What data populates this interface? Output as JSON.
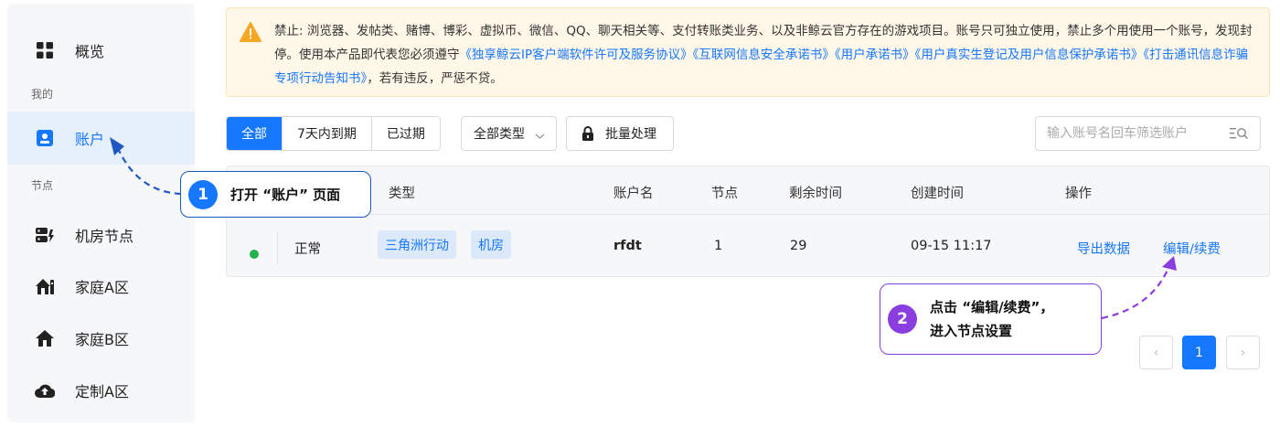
{
  "sidebar": {
    "overview_label": "概览",
    "group_mine": "我的",
    "account_label": "账户",
    "group_nodes": "节点",
    "items": [
      {
        "label": "机房节点"
      },
      {
        "label": "家庭A区"
      },
      {
        "label": "家庭B区"
      },
      {
        "label": "定制A区"
      }
    ]
  },
  "notice": {
    "text_before": "禁止: 浏览器、发帖类、赌博、博彩、虚拟币、微信、QQ、聊天相关等、支付转账类业务、以及非鲸云官方存在的游戏项目。账号只可独立使用，禁止多个用使用一个账号，发现封停。使用本产品即代表您必须遵守",
    "links": [
      "《独享鲸云IP客户端软件许可及服务协议》",
      "《互联网信息安全承诺书》",
      "《用户承诺书》",
      "《用户真实生登记及用户信息保护承诺书》",
      "《打击通讯信息诈骗专项行动告知书》"
    ],
    "text_after": "，若有违反，严惩不贷。"
  },
  "toolbar": {
    "tabs": [
      "全部",
      "7天内到期",
      "已过期"
    ],
    "active_tab": "全部",
    "type_select": "全部类型",
    "batch_label": "批量处理",
    "search_placeholder": "输入账号名回车筛选账户"
  },
  "table": {
    "headers": {
      "type": "类型",
      "account": "账户名",
      "node": "节点",
      "remaining": "剩余时间",
      "created": "创建时间",
      "actions": "操作"
    },
    "rows": [
      {
        "status": "正常",
        "tags": [
          "三角洲行动",
          "机房"
        ],
        "account": "rfdt",
        "node": "1",
        "remaining": "29",
        "created": "09-15 11:17",
        "action_export": "导出数据",
        "action_edit": "编辑/续费"
      }
    ]
  },
  "pagination": {
    "prev": "‹",
    "current": "1",
    "next": "›"
  },
  "callouts": [
    {
      "number": "1",
      "text": "打开 “账户” 页面",
      "color": "#1677ff"
    },
    {
      "number": "2",
      "line1": "点击 “编辑/续费”，",
      "line2": "进入节点设置",
      "color": "#8a3ee0"
    }
  ],
  "colors": {
    "primary": "#1677ff",
    "status_ok": "#22b14c",
    "warning": "#f5a623",
    "callout2": "#8a3ee0"
  }
}
